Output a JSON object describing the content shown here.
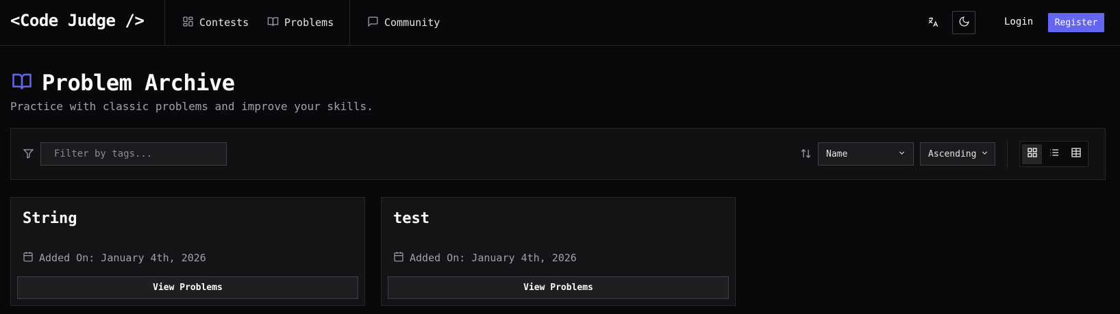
{
  "brand": "<Code Judge />",
  "nav": {
    "contests": "Contests",
    "problems": "Problems",
    "community": "Community"
  },
  "auth": {
    "login": "Login",
    "register": "Register"
  },
  "colors": {
    "accent": "#6366f1",
    "background": "#09090b"
  },
  "page": {
    "title": "Problem Archive",
    "subtitle": "Practice with classic problems and improve your skills."
  },
  "filters": {
    "tags_placeholder": "Filter by tags...",
    "sort_field": "Name",
    "sort_order": "Ascending"
  },
  "view_modes": [
    "grid",
    "list",
    "table"
  ],
  "active_view": "grid",
  "problems": [
    {
      "title": "String",
      "added": "Added On: January 4th, 2026",
      "button": "View Problems"
    },
    {
      "title": "test",
      "added": "Added On: January 4th, 2026",
      "button": "View Problems"
    }
  ]
}
